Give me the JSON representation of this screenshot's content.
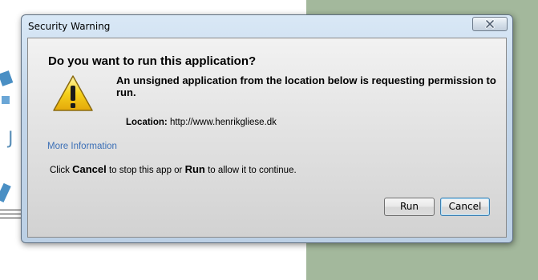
{
  "window": {
    "title": "Security Warning"
  },
  "dialog": {
    "heading": "Do you want to run this application?",
    "message": "An unsigned application from the location below is requesting permission to run.",
    "location_label": "Location:",
    "location_value": "http://www.henrikgliese.dk",
    "more_info_link": "More Information",
    "instruction": {
      "prefix": "Click",
      "cancel_word": "Cancel",
      "middle": "to stop this app or",
      "run_word": "Run",
      "suffix": "to allow it to continue."
    }
  },
  "buttons": {
    "run": "Run",
    "cancel": "Cancel"
  },
  "icons": {
    "warning": "warning-icon",
    "close": "close-icon"
  },
  "colors": {
    "link": "#3b6fb6",
    "warning_fill": "#f6d21c",
    "background_accent": "#a3b89c"
  }
}
